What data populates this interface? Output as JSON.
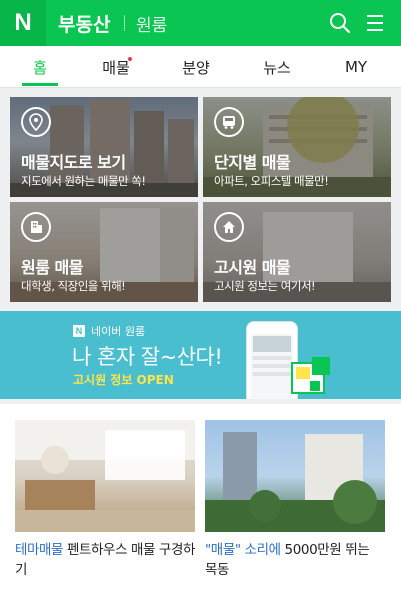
{
  "header": {
    "logo": "N",
    "title": "부동산",
    "subtitle": "원룸",
    "bg_color": "#0ac551"
  },
  "tabs": [
    {
      "label": "홈",
      "active": true
    },
    {
      "label": "매물",
      "has_new_dot": true
    },
    {
      "label": "분양"
    },
    {
      "label": "뉴스"
    },
    {
      "label": "MY"
    }
  ],
  "tiles": [
    {
      "title": "매물지도로 보기",
      "desc": "지도에서 원하는 매물만 쏙!",
      "icon": "map-pin-icon"
    },
    {
      "title": "단지별 매물",
      "desc": "아파트, 오피스텔 매물만!",
      "icon": "bus-icon"
    },
    {
      "title": "원룸 매물",
      "desc": "대학생, 직장인을 위해!",
      "icon": "building-icon"
    },
    {
      "title": "고시원 매물",
      "desc": "고시원 정보는 여기서!",
      "icon": "home-icon"
    }
  ],
  "banner": {
    "brand": "네이버 원룸",
    "headline": "나 혼자 잘~산다!",
    "sub": "고시원 정보 OPEN",
    "bg_color": "#48bece"
  },
  "cards": [
    {
      "tag": "테마매물",
      "text": "펜트하우스 매물 구경하기"
    },
    {
      "tag": "\"매물\" 소리에",
      "text": "5000만원 뛰는 목동"
    }
  ]
}
